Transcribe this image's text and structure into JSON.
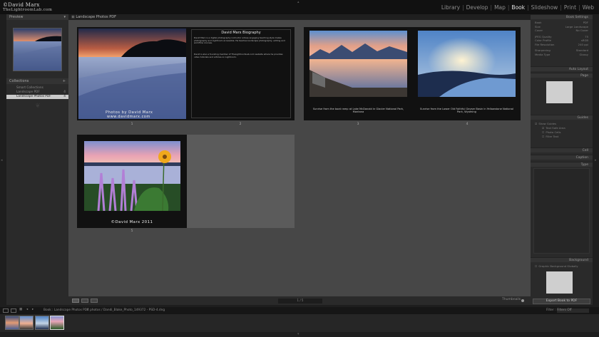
{
  "branding": {
    "line1": "©David Marx",
    "line2": "TheLightroomLab.com"
  },
  "modules": [
    "Library",
    "Develop",
    "Map",
    "Book",
    "Slideshow",
    "Print",
    "Web"
  ],
  "active_module": "Book",
  "left_panel": {
    "preview_title": "Preview",
    "collections_title": "Collections",
    "collections": [
      {
        "label": "Smart Collections",
        "count": ""
      },
      {
        "label": "Landscape PDF",
        "count": "4"
      },
      {
        "label": "Landscape Photos PDF",
        "count": "4"
      }
    ]
  },
  "document": {
    "title": "Landscape Photos PDF"
  },
  "pages": {
    "biography_title": "David Marx Biography",
    "biography_p1": "David Marx is a digital photography instructor whose engaging teaching style makes photography and Lightroom accessible. He teaches landscape photography, editing and workflow courses.",
    "biography_p2": "David is also a founding member of TheLightroomLab.com website where he provides video tutorials and articles on Lightroom.",
    "photo_credit_1": "Photos by David Marx",
    "photo_credit_2": "www.davidmarx.com",
    "caption_3": "Sunrise from the boat ramp at Lake McDonald in Glacier National Park, Montana",
    "caption_4": "Sunrise from the Lower Old Faithful Geyser Basin in Yellowstone National Park, Wyoming",
    "copyright": "©David Marx 2011",
    "page_numbers": [
      "1",
      "2",
      "3",
      "4",
      "5"
    ]
  },
  "bottom_bar": {
    "page_indicator": "1 / 5",
    "thumbnails_label": "Thumbnails"
  },
  "right_panel": {
    "title": "Book Settings",
    "book_settings": [
      {
        "label": "Book",
        "value": "PDF"
      },
      {
        "label": "Size",
        "value": "Large Landscape"
      },
      {
        "label": "Cover",
        "value": "No Cover"
      },
      {
        "label": "JPEG Quality",
        "value": "75"
      },
      {
        "label": "Color Profile",
        "value": "sRGB"
      },
      {
        "label": "File Resolution",
        "value": "240 ppi"
      },
      {
        "label": "Sharpening",
        "value": "Standard"
      },
      {
        "label": "Media Type",
        "value": "Glossy"
      }
    ],
    "sections": [
      "Auto Layout",
      "Page",
      "Guides",
      "Cell",
      "Caption",
      "Type",
      "Background"
    ],
    "guides": [
      "Show Guides",
      "Text Safe Area",
      "Photo Cells",
      "Filler Text"
    ],
    "export_label": "Export Book to PDF",
    "background_option": "Graphic Background Globally"
  },
  "filmstrip": {
    "book_path": "Book : Landscape Photos PDF",
    "photos_info": "4 photos / Dandi_Blake_Photo_149372 - PSD-4.dng",
    "filter_label": "Filter :",
    "filter_value": "Filters Off"
  }
}
